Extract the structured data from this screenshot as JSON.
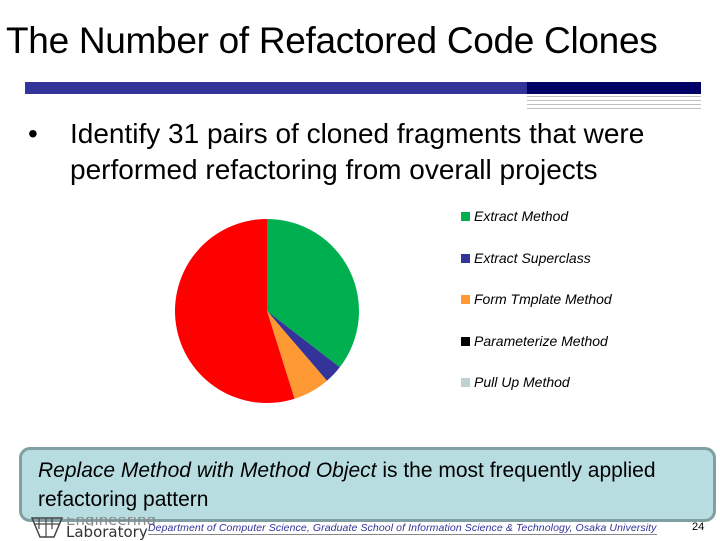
{
  "slide": {
    "title": "The Number of Refactored Code Clones",
    "bullet_symbol": "•",
    "bullet_text": "Identify 31 pairs of cloned fragments that were performed refactoring from overall projects",
    "callout": {
      "emphasis": "Replace Method with Method Object",
      "rest": " is the most frequently applied refactoring pattern"
    },
    "footer": {
      "logo_line1": "Engineering",
      "logo_line2": "Laboratory",
      "department": "Department of Computer Science, Graduate School of Information Science & Technology, Osaka University",
      "page_number": "24"
    },
    "colors": {
      "rule_primary": "#333399",
      "rule_dark": "#000066",
      "callout_fill": "#b7dde1",
      "callout_border": "#7f9fa3"
    }
  },
  "chart_data": {
    "type": "pie",
    "title": "",
    "total": 31,
    "start_angle": "12 o'clock",
    "direction": "clockwise",
    "legend_position": "right",
    "categories": [
      "Extract Method",
      "Extract Superclass",
      "Form Tmplate Method",
      "Parameterize Method",
      "Pull Up Method",
      "Replace Method with Method Object"
    ],
    "values": [
      11,
      1,
      2,
      0,
      0,
      17
    ],
    "colors": [
      "#00b050",
      "#333399",
      "#ff9933",
      "#000000",
      "#c0d0d0",
      "#ff0000"
    ],
    "legend_visible": [
      "Extract Method",
      "Extract Superclass",
      "Form Tmplate Method",
      "Parameterize Method",
      "Pull Up Method"
    ]
  }
}
